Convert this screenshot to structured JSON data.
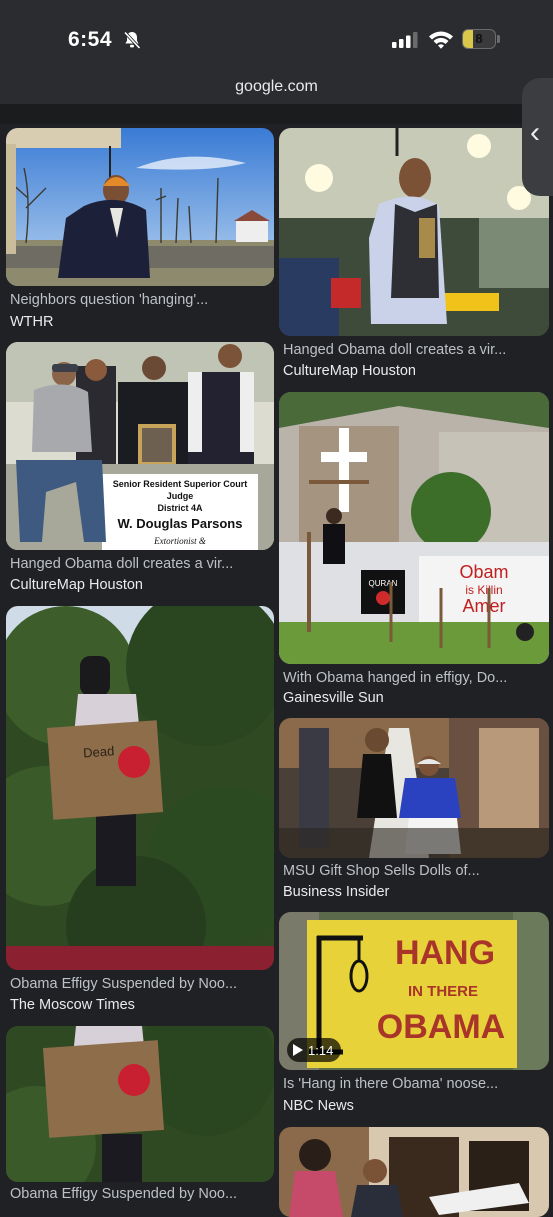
{
  "status": {
    "time": "6:54",
    "battery": "8"
  },
  "browser": {
    "url": "google.com"
  },
  "left": [
    {
      "caption": "Neighbors question 'hanging'...",
      "source": "WTHR"
    },
    {
      "caption": "Hanged Obama doll creates a vir...",
      "source": "CultureMap Houston",
      "sign_lines": [
        "Senior Resident Superior Court",
        "Judge",
        "District 4A",
        "W. Douglas Parsons",
        "Extortionist &"
      ]
    },
    {
      "caption": "Obama Effigy Suspended by Noo...",
      "source": "The Moscow Times"
    },
    {
      "caption": "Obama Effigy Suspended by Noo...",
      "source": ""
    }
  ],
  "right": [
    {
      "caption": "Hanged Obama doll creates a vir...",
      "source": "CultureMap Houston"
    },
    {
      "caption": "With Obama hanged in effigy, Do...",
      "source": "Gainesville Sun",
      "sign_lines": [
        "Obam",
        "is Killin",
        "Amer",
        "QURAN"
      ]
    },
    {
      "caption": "MSU Gift Shop Sells Dolls of...",
      "source": "Business Insider"
    },
    {
      "caption": "Is 'Hang in there Obama' noose...",
      "source": "NBC News",
      "video_duration": "1:14",
      "sign_lines": [
        "HANG",
        "IN THERE",
        "OBAMA"
      ]
    },
    {
      "caption": "",
      "source": ""
    }
  ],
  "colors": {
    "background": "#202124",
    "caption": "#bdc1c6",
    "source": "#e8eaed"
  },
  "icons": [
    "bell-slash-icon",
    "signal-icon",
    "wifi-icon",
    "battery-icon",
    "play-icon",
    "chevron-left-icon"
  ]
}
